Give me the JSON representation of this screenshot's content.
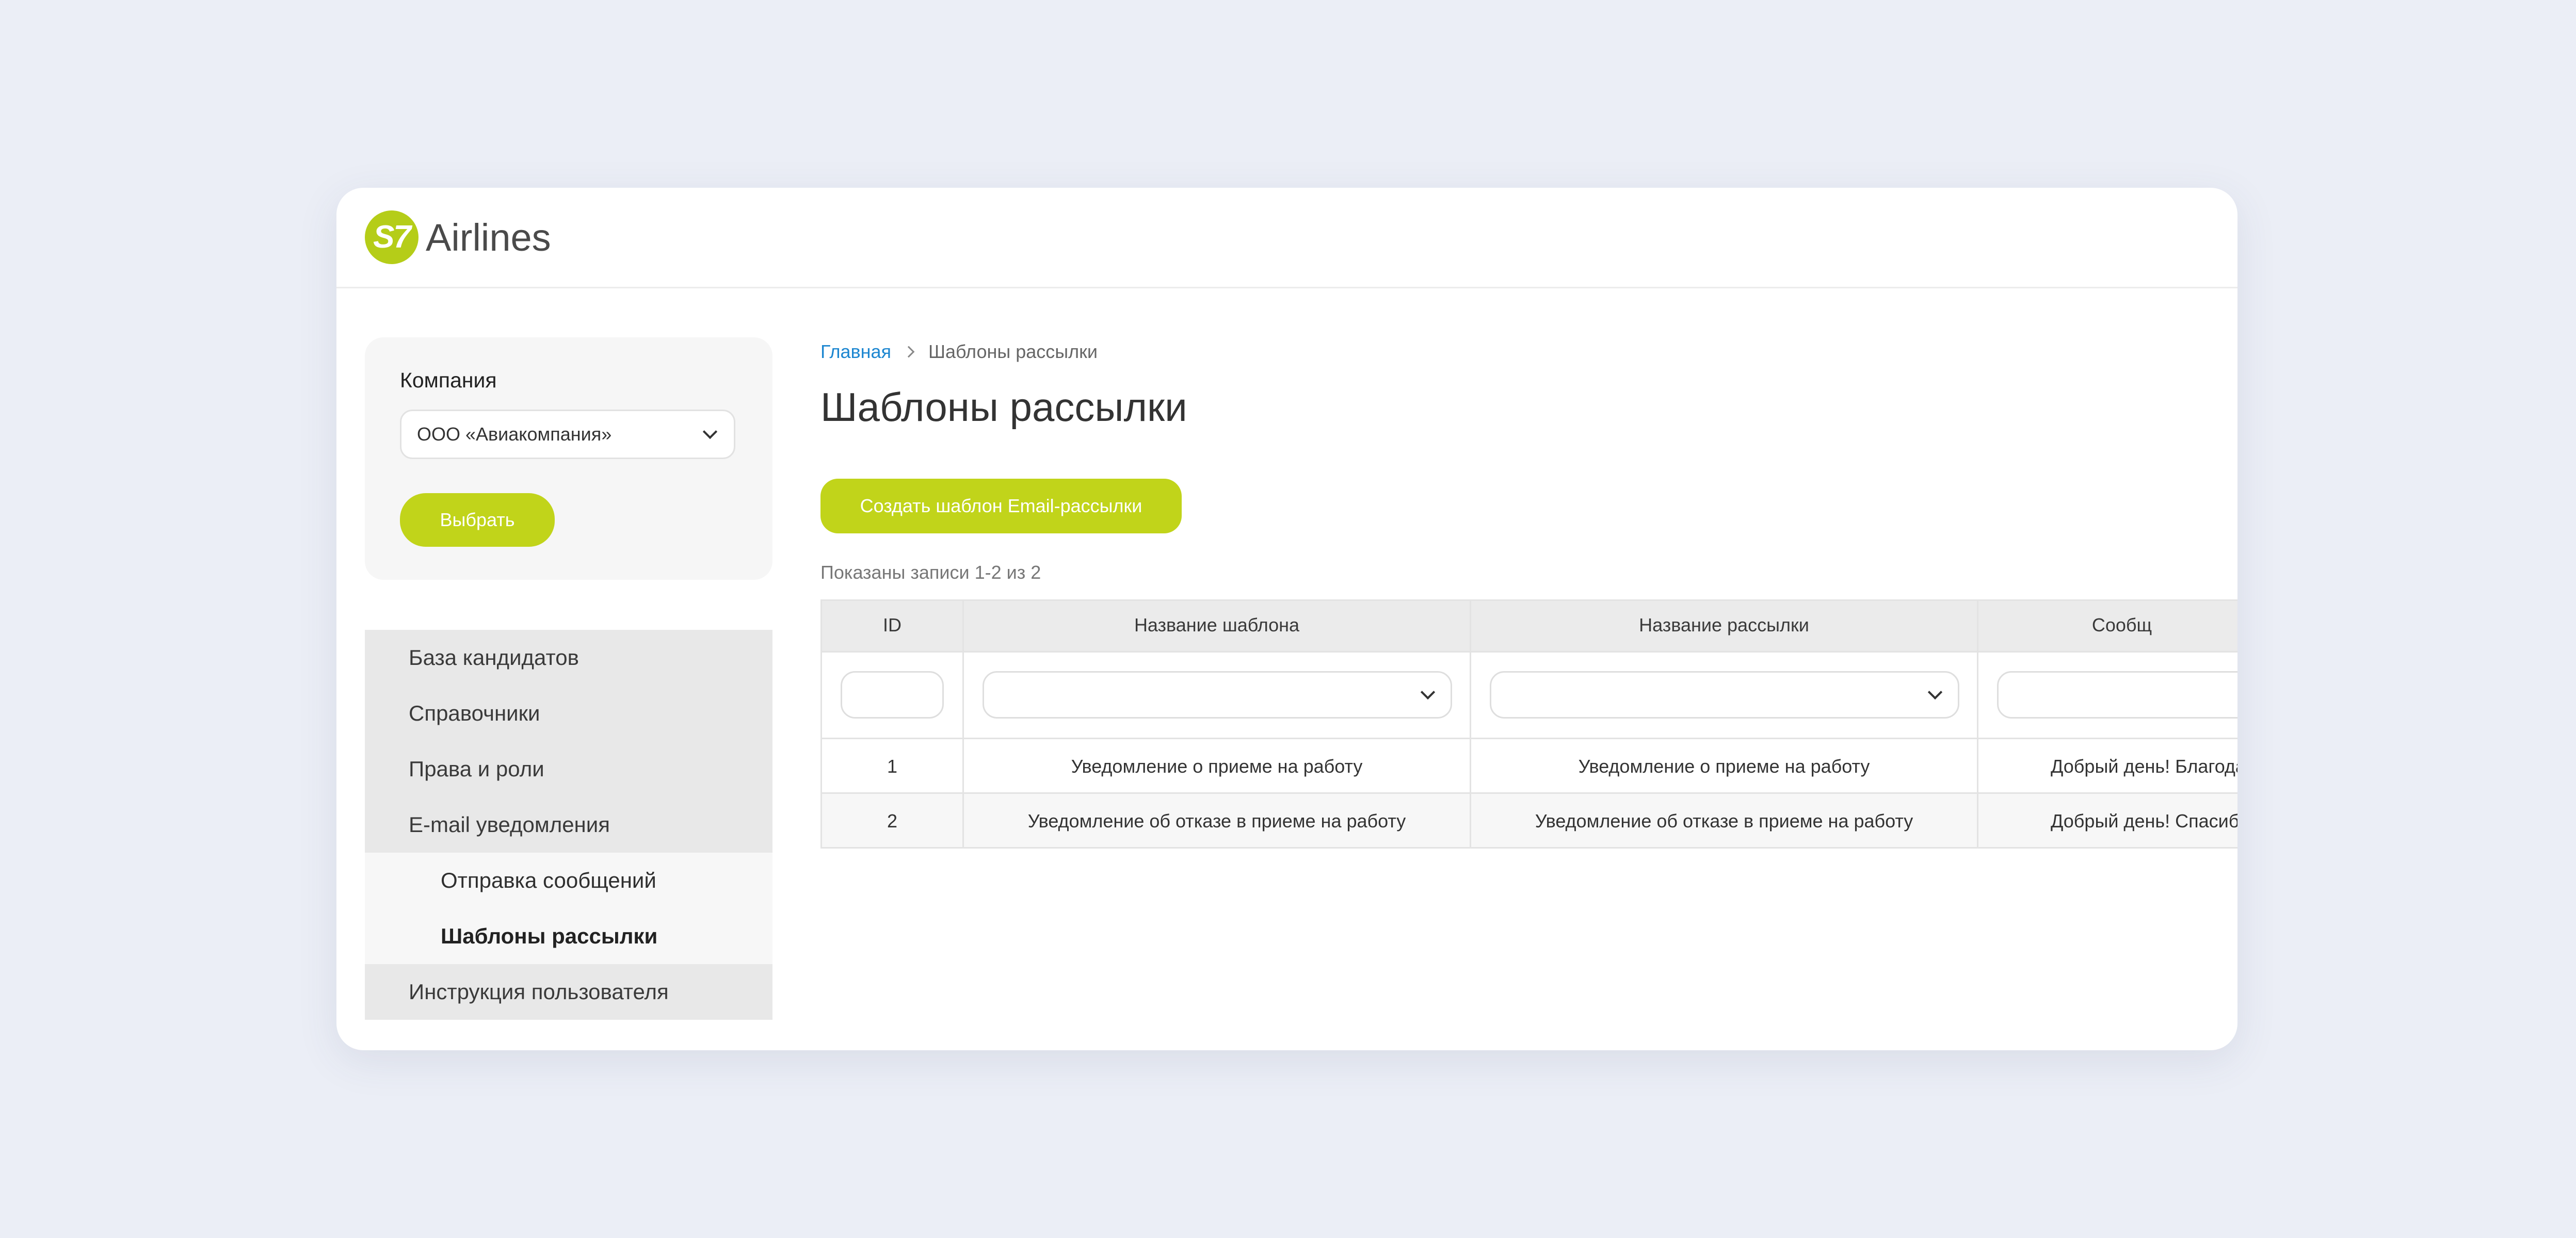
{
  "header": {
    "logo_mark": "S7",
    "logo_text": "Airlines"
  },
  "company": {
    "label": "Компания",
    "selected": "ООО «Авиакомпания»",
    "choose_button": "Выбрать"
  },
  "sidebar": {
    "items": [
      {
        "label": "База кандидатов"
      },
      {
        "label": "Справочники"
      },
      {
        "label": "Права и роли"
      },
      {
        "label": "E-mail уведомления"
      },
      {
        "label": "Отправка сообщений"
      },
      {
        "label": "Шаблоны рассылки"
      },
      {
        "label": "Инструкция пользователя"
      }
    ]
  },
  "breadcrumb": {
    "home": "Главная",
    "current": "Шаблоны рассылки"
  },
  "page": {
    "title": "Шаблоны рассылки",
    "create_button": "Создать шаблон Email-рассылки",
    "records_info": "Показаны записи 1-2 из 2"
  },
  "table": {
    "columns": [
      "ID",
      "Название шаблона",
      "Название рассылки",
      "Сообщ"
    ],
    "rows": [
      {
        "id": "1",
        "template": "Уведомление о приеме на работу",
        "mailing": "Уведомление о приеме на работу",
        "message": "Добрый день! Благода"
      },
      {
        "id": "2",
        "template": "Уведомление об отказе в приеме на работу",
        "mailing": "Уведомление об отказе в приеме на работу",
        "message": "Добрый день! Спасиб"
      }
    ]
  },
  "colors": {
    "accent": "#c1d41a",
    "logo": "#b5cd18",
    "link": "#1c86d0",
    "background": "#ebeef6"
  }
}
